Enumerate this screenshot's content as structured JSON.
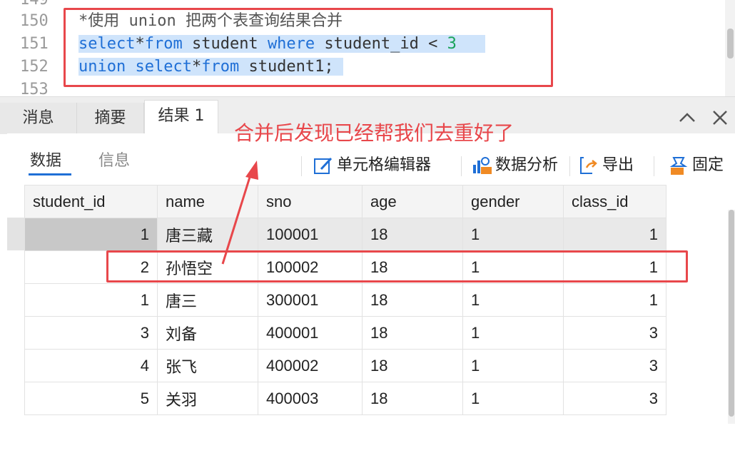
{
  "editor": {
    "line_numbers": [
      "149",
      "150",
      "151",
      "152",
      "153"
    ],
    "lines": {
      "l150": "*使用 union 把两个表查询结果合并",
      "l151_a": "select",
      "l151_b": "*",
      "l151_c": "from",
      "l151_d": " student ",
      "l151_e": "where",
      "l151_f": " student_id < ",
      "l151_g": "3",
      "l152_a": "union",
      "l152_b": " ",
      "l152_c": "select",
      "l152_d": "*",
      "l152_e": "from",
      "l152_f": " student1;"
    }
  },
  "panel_tabs": [
    "消息",
    "摘要",
    "结果 1"
  ],
  "subtabs": [
    "数据",
    "信息"
  ],
  "toolbar": {
    "cell_editor": "单元格编辑器",
    "data_analysis": "数据分析",
    "export": "导出",
    "pin": "固定"
  },
  "annotation": "合并后发现已经帮我们去重好了",
  "grid": {
    "columns": [
      "student_id",
      "name",
      "sno",
      "age",
      "gender",
      "class_id"
    ],
    "rows": [
      [
        "1",
        "唐三藏",
        "100001",
        "18",
        "1",
        "1"
      ],
      [
        "2",
        "孙悟空",
        "100002",
        "18",
        "1",
        "1"
      ],
      [
        "1",
        "唐三",
        "300001",
        "18",
        "1",
        "1"
      ],
      [
        "3",
        "刘备",
        "400001",
        "18",
        "1",
        "3"
      ],
      [
        "4",
        "张飞",
        "400002",
        "18",
        "1",
        "3"
      ],
      [
        "5",
        "关羽",
        "400003",
        "18",
        "1",
        "3"
      ]
    ]
  },
  "colors": {
    "accent": "#1f6fd6",
    "annotation_red": "#e8474b",
    "selection": "#cfe4fb"
  },
  "icons": [
    "edit-icon",
    "data-analysis-icon",
    "export-icon",
    "pin-icon",
    "chevron-up-icon",
    "close-icon"
  ]
}
